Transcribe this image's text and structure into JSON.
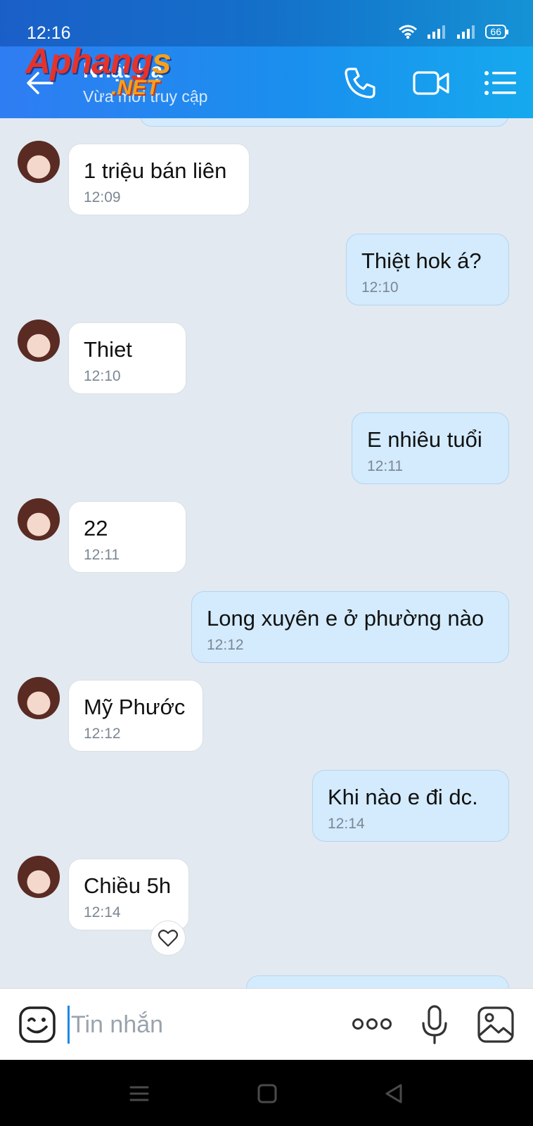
{
  "status_bar": {
    "time": "12:16",
    "battery": "66",
    "wifi_icon": "wifi-icon",
    "signal_icon": "signal-icon"
  },
  "header": {
    "contact_name": "Nhật Hạ",
    "contact_status": "Vừa mới truy cập",
    "back_icon": "arrow-left-icon",
    "actions": [
      "phone-icon",
      "video-camera-icon",
      "menu-list-icon"
    ]
  },
  "watermark": {
    "main": "Aphang",
    "s": "s",
    "net": ".NET"
  },
  "messages": [
    {
      "side": "in",
      "text": "1 triệu bán liên",
      "time": "12:09"
    },
    {
      "side": "out",
      "text": "Thiệt hok á?",
      "time": "12:10"
    },
    {
      "side": "in",
      "text": "Thiet",
      "time": "12:10"
    },
    {
      "side": "out",
      "text": "E nhiêu tuổi",
      "time": "12:11"
    },
    {
      "side": "in",
      "text": "22",
      "time": "12:11"
    },
    {
      "side": "out",
      "text": "Long xuyên e ở phường nào",
      "time": "12:12"
    },
    {
      "side": "in",
      "text": "Mỹ Phước",
      "time": "12:12"
    },
    {
      "side": "out",
      "text": "Khi nào e đi dc.",
      "time": "12:14"
    },
    {
      "side": "in",
      "text": "Chiều 5h",
      "time": "12:14"
    }
  ],
  "composer": {
    "placeholder": "Tin nhắn",
    "icons": [
      "emoji-icon",
      "more-options-icon",
      "microphone-icon",
      "image-icon"
    ]
  },
  "nav_bar": {
    "icons": [
      "recent-apps-icon",
      "home-icon",
      "back-triangle-icon"
    ]
  },
  "colors": {
    "accent": "#1e88e5",
    "incoming_bubble": "#ffffff",
    "outgoing_bubble": "#d3ebfd",
    "chat_bg": "#e2e9f1"
  }
}
